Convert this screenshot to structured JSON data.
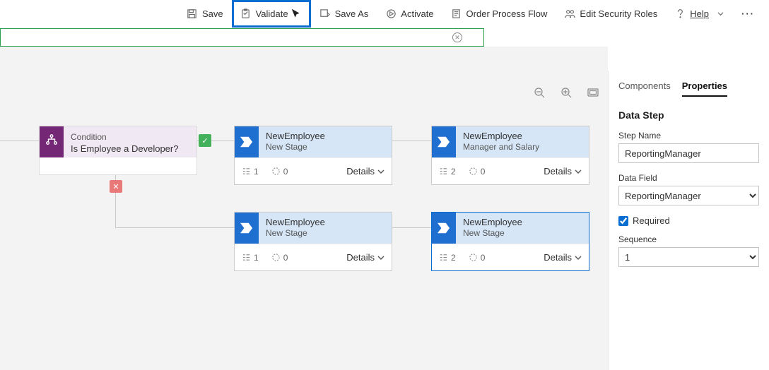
{
  "toolbar": {
    "save": "Save",
    "validate": "Validate",
    "saveAs": "Save As",
    "activate": "Activate",
    "orderFlow": "Order Process Flow",
    "editRoles": "Edit Security Roles",
    "help": "Help"
  },
  "condition": {
    "title": "Condition",
    "question": "Is Employee a Developer?"
  },
  "stages": {
    "s1": {
      "title": "NewEmployee",
      "subtitle": "New Stage",
      "count": "1",
      "step": "0"
    },
    "s2": {
      "title": "NewEmployee",
      "subtitle": "Manager and Salary",
      "count": "2",
      "step": "0"
    },
    "s3": {
      "title": "NewEmployee",
      "subtitle": "New Stage",
      "count": "1",
      "step": "0"
    },
    "s4": {
      "title": "NewEmployee",
      "subtitle": "New Stage",
      "count": "2",
      "step": "0"
    },
    "detailsLabel": "Details"
  },
  "panel": {
    "tabComponents": "Components",
    "tabProperties": "Properties",
    "sectionTitle": "Data Step",
    "stepNameLabel": "Step Name",
    "stepNameValue": "ReportingManager",
    "dataFieldLabel": "Data Field",
    "dataFieldValue": "ReportingManager",
    "requiredLabel": "Required",
    "sequenceLabel": "Sequence",
    "sequenceValue": "1"
  }
}
